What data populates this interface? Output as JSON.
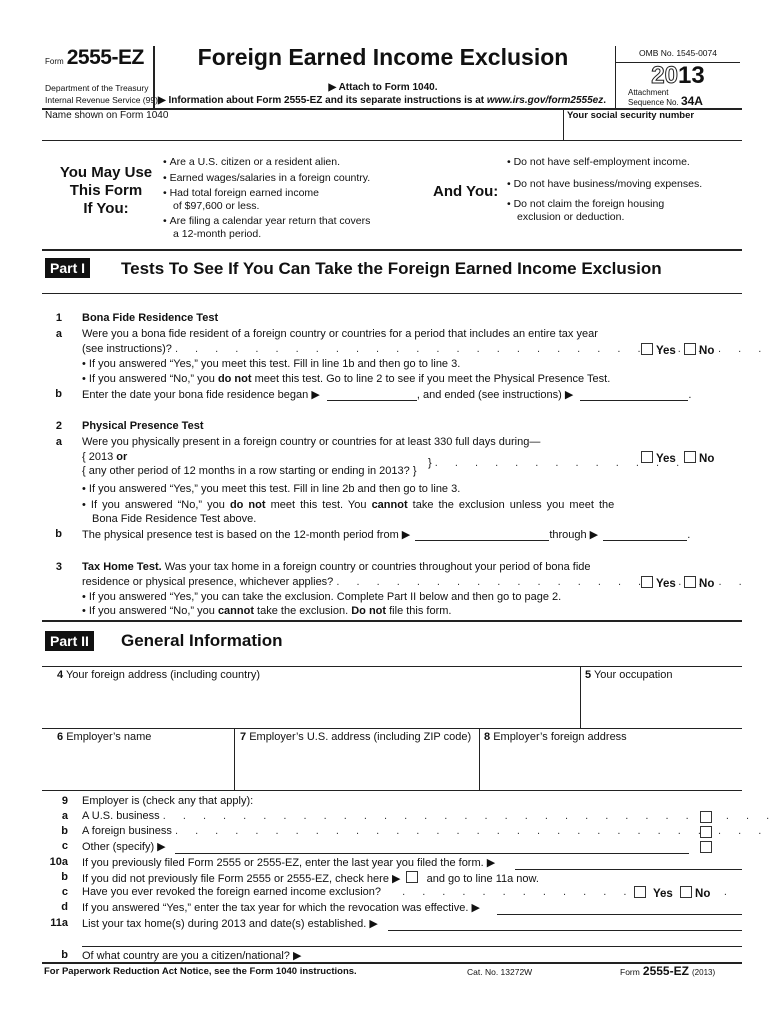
{
  "header": {
    "form_prefix": "Form",
    "form_number": "2555-EZ",
    "department_line1": "Department of the Treasury",
    "department_line2": "Internal Revenue Service (99)",
    "title": "Foreign Earned Income Exclusion",
    "attach_note": "▶ Attach to Form 1040.",
    "info_note_prefix": "▶ Information about Form 2555-EZ and its separate instructions is at ",
    "info_note_url": "www.irs.gov/form2555ez",
    "info_note_suffix": ".",
    "omb": "OMB No. 1545-0074",
    "year_outline": "20",
    "year_bold": "13",
    "attachment_label1": "Attachment",
    "attachment_label2": "Sequence No.",
    "sequence_no": "34A",
    "name_label": "Name shown on Form 1040",
    "ssn_label": "Your social security number"
  },
  "eligibility": {
    "left_heading_line1": "You May Use",
    "left_heading_line2": "This Form",
    "left_heading_line3": "If You:",
    "left_items": [
      "Are a U.S. citizen or a resident alien.",
      "Earned wages/salaries in a foreign country.",
      "Had total foreign earned income",
      "of $97,600 or less.",
      "Are filing a calendar year return that  covers",
      "a 12-month period."
    ],
    "right_heading": "And You:",
    "right_items": [
      "Do not have self-employment income.",
      "Do not have business/moving expenses.",
      "Do not claim the foreign housing",
      "exclusion or deduction."
    ]
  },
  "part1": {
    "badge": "Part I",
    "title": "Tests To See If You Can Take the Foreign Earned Income Exclusion",
    "yes": "Yes",
    "no": "No",
    "line1": {
      "num": "1",
      "title": "Bona Fide Residence Test",
      "a_letter": "a",
      "a_text1": "Were you a bona fide resident of a foreign country or countries for a period that includes an entire tax year",
      "a_text2": "(see instructions)?",
      "bullet_yes": "If you answered “Yes,” you meet this test. Fill in line 1b and then go to line 3.",
      "bullet_no_pre": "If you answered “No,” you ",
      "bullet_no_bold": "do not",
      "bullet_no_post": " meet this test. Go to line 2 to see if you meet the Physical Presence Test.",
      "b_letter": "b",
      "b_text1": "Enter the date your bona fide residence began ▶",
      "b_text2": ", and ended (see instructions) ▶",
      "b_began_value": "",
      "b_ended_value": ""
    },
    "line2": {
      "num": "2",
      "title": "Physical Presence Test",
      "a_letter": "a",
      "a_text": "Were you physically present in a foreign country or countries for at least 330 full days during—",
      "opt1_pre": "2013 ",
      "opt1_bold": "or",
      "opt2": "any other period of 12 months in a row starting or ending in 2013?",
      "bullet_yes": "If you answered “Yes,” you meet this test. Fill in line 2b and then go to line 3.",
      "bullet_no_pre": "If you answered “No,” you ",
      "bullet_no_bold1": "do not",
      "bullet_no_mid": " meet this test. You ",
      "bullet_no_bold2": "cannot",
      "bullet_no_post": " take the exclusion unless you meet the",
      "bullet_no_line2": "Bona Fide Residence Test above.",
      "b_letter": "b",
      "b_text1": "The physical presence test is based on the 12-month period from ▶",
      "b_text2": "through ▶",
      "b_from_value": "",
      "b_through_value": ""
    },
    "line3": {
      "num": "3",
      "title": "Tax Home Test.",
      "text1": " Was your tax home in a foreign country or countries throughout your period of bona fide",
      "text2": "residence or physical presence, whichever applies?",
      "bullet_yes": "If you answered “Yes,” you can take the exclusion. Complete Part II below and then go to page 2.",
      "bullet_no_pre": "If you answered “No,” you ",
      "bullet_no_bold1": "cannot",
      "bullet_no_mid": " take the exclusion. ",
      "bullet_no_bold2": "Do not",
      "bullet_no_post": " file this form."
    }
  },
  "part2": {
    "badge": "Part II",
    "title": "General Information",
    "field4_num": "4",
    "field4_label": "Your foreign address (including country)",
    "field5_num": "5",
    "field5_label": "Your occupation",
    "field6_num": "6",
    "field6_label": "Employer’s name",
    "field7_num": "7",
    "field7_label": "Employer’s U.S. address (including ZIP code)",
    "field8_num": "8",
    "field8_label": "Employer’s foreign address",
    "line9": {
      "num": "9",
      "text": "Employer is (check any that apply):",
      "a_letter": "a",
      "a_text": "A U.S. business",
      "b_letter": "b",
      "b_text": "A foreign business",
      "c_letter": "c",
      "c_text": "Other (specify) ▶"
    },
    "line10": {
      "a_num": "10a",
      "a_text": "If you previously filed Form 2555 or 2555-EZ, enter the last year you filed the form. ▶",
      "b_letter": "b",
      "b_text1": "If you did not previously file Form 2555 or 2555-EZ, check here ▶",
      "b_text2": "and go to line 11a now.",
      "c_letter": "c",
      "c_text": "Have you ever revoked the foreign earned income exclusion?",
      "d_letter": "d",
      "d_text": "If you answered “Yes,” enter the tax year for which the revocation was effective. ▶"
    },
    "line11": {
      "a_num": "11a",
      "a_text": "List your tax home(s) during 2013 and date(s) established. ▶",
      "b_letter": "b",
      "b_text": "Of what country are you a citizen/national? ▶"
    }
  },
  "footer": {
    "paperwork": "For Paperwork Reduction Act Notice, see the Form 1040 instructions.",
    "cat_no": "Cat. No. 13272W",
    "form_prefix": "Form",
    "form_number": "2555-EZ",
    "form_year": "(2013)"
  }
}
